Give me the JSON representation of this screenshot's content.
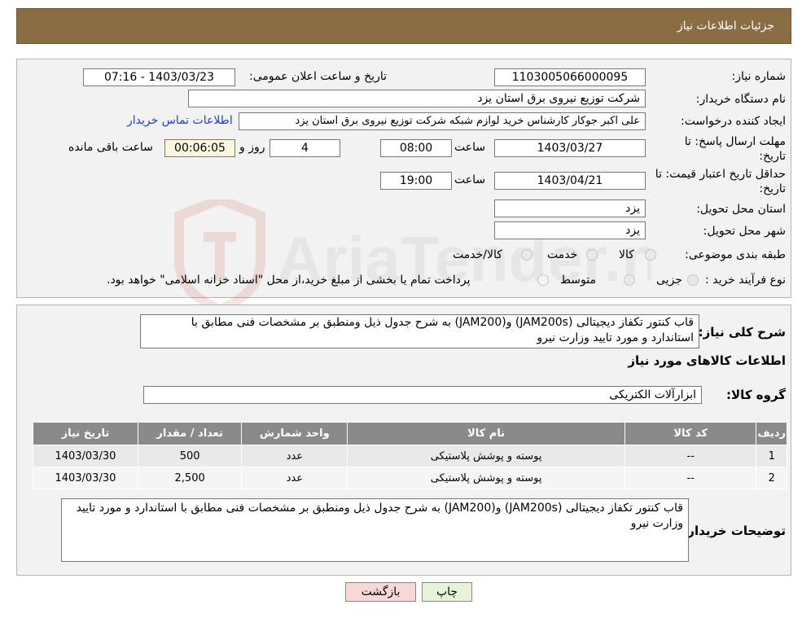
{
  "header": {
    "title": "جزئیات اطلاعات نیاز"
  },
  "form": {
    "need_number_label": "شماره نیاز:",
    "need_number": "1103005066000095",
    "announce_label": "تاریخ و ساعت اعلان عمومی:",
    "announce_value": "1403/03/23 - 07:16",
    "buyer_org_label": "نام دستگاه خریدار:",
    "buyer_org": "شرکت توزیع نیروی برق استان یزد",
    "creator_label": "ایجاد کننده درخواست:",
    "creator": "علی اکبر  جوکار  کارشناس خرید لوازم شبکه  شرکت توزیع نیروی برق استان یزد",
    "contact_link": "اطلاعات تماس خریدار",
    "reply_deadline_label": "مهلت ارسال پاسخ: تا",
    "reply_deadline_label2": "تاریخ:",
    "reply_date": "1403/03/27",
    "time_label": "ساعت",
    "reply_time": "08:00",
    "days_value": "4",
    "days_label": "روز و",
    "remaining_value": "00:06:05",
    "remaining_label": "ساعت باقی مانده",
    "validity_label": "حداقل تاریخ اعتبار قیمت: تا",
    "validity_label2": "تاریخ:",
    "validity_date": "1403/04/21",
    "validity_time": "19:00",
    "province_label": "استان محل تحویل:",
    "province": "یزد",
    "city_label": "شهر محل تحویل:",
    "city": "یزد",
    "category_label": "طبقه بندی موضوعی:",
    "category_options": [
      "کالا",
      "خدمت",
      "کالا/خدمت"
    ],
    "process_label": "نوع فرآیند خرید :",
    "process_options": [
      "جزیی",
      "متوسط"
    ],
    "process_note": "پرداخت تمام یا بخشی از مبلغ خرید،از محل \"اسناد خزانه اسلامی\" خواهد بود."
  },
  "details": {
    "summary_label": "شرح کلی نیاز:",
    "summary": "قاب کنتور تکفاز دیجیتالی (JAM200s) و(JAM200) به شرح جدول ذیل ومنطبق بر  مشخصات فنی مطابق با استاندارد و مورد تایید وزارت نیرو",
    "goods_title": "اطلاعات کالاهای مورد نیاز",
    "group_label": "گروه کالا:",
    "group_value": "ابزارآلات الکتریکی"
  },
  "table": {
    "headers": [
      "ردیف",
      "کد کالا",
      "نام کالا",
      "واحد شمارش",
      "تعداد / مقدار",
      "تاریخ نیاز"
    ],
    "rows": [
      [
        "1",
        "--",
        "پوسته و پوشش پلاستیکی",
        "عدد",
        "500",
        "1403/03/30"
      ],
      [
        "2",
        "--",
        "پوسته و پوشش پلاستیکی",
        "عدد",
        "2,500",
        "1403/03/30"
      ]
    ]
  },
  "buyer_notes": {
    "label": "توضیحات خریدار:",
    "text": "قاب کنتور تکفاز دیجیتالی (JAM200s) و(JAM200) به شرح جدول ذیل ومنطبق بر  مشخصات فنی مطابق با استاندارد و مورد تایید وزارت نیرو"
  },
  "buttons": {
    "print": "چاپ",
    "back": "بازگشت"
  },
  "watermark_text": "AriaTender.neT",
  "colors": {
    "header": "#8b6d43",
    "link": "#1a3fd8",
    "back_button": "#f8d7d7",
    "print_button": "#e6f3d8"
  }
}
